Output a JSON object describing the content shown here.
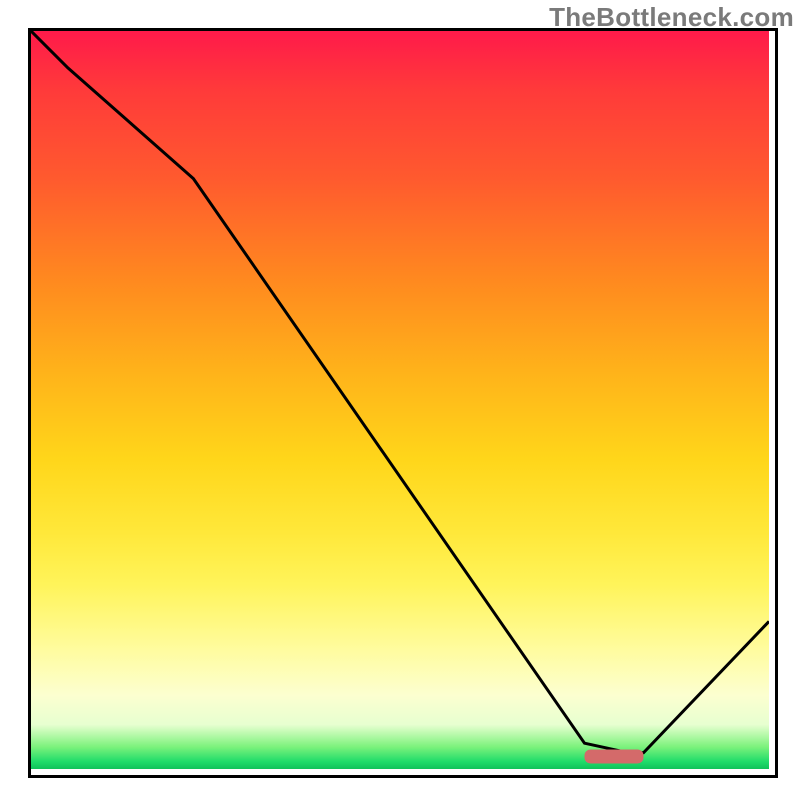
{
  "watermark": "TheBottleneck.com",
  "chart_data": {
    "type": "line",
    "title": "",
    "xlabel": "",
    "ylabel": "",
    "x": [
      0.0,
      0.05,
      0.22,
      0.75,
      0.81,
      0.83,
      1.0
    ],
    "values": [
      1.0,
      0.95,
      0.8,
      0.035,
      0.022,
      0.022,
      0.2
    ],
    "xlim": [
      0,
      1
    ],
    "ylim": [
      0,
      1
    ],
    "annotations": {
      "marker_rect": {
        "x0": 0.75,
        "x1": 0.83,
        "y": 0.017
      }
    },
    "background": {
      "type": "vertical-gradient",
      "stops": [
        {
          "pos": 0.0,
          "color": "#ff1a4a"
        },
        {
          "pos": 0.5,
          "color": "#ffd61a"
        },
        {
          "pos": 0.8,
          "color": "#fff45a"
        },
        {
          "pos": 1.0,
          "color": "#10c25a"
        }
      ]
    }
  }
}
